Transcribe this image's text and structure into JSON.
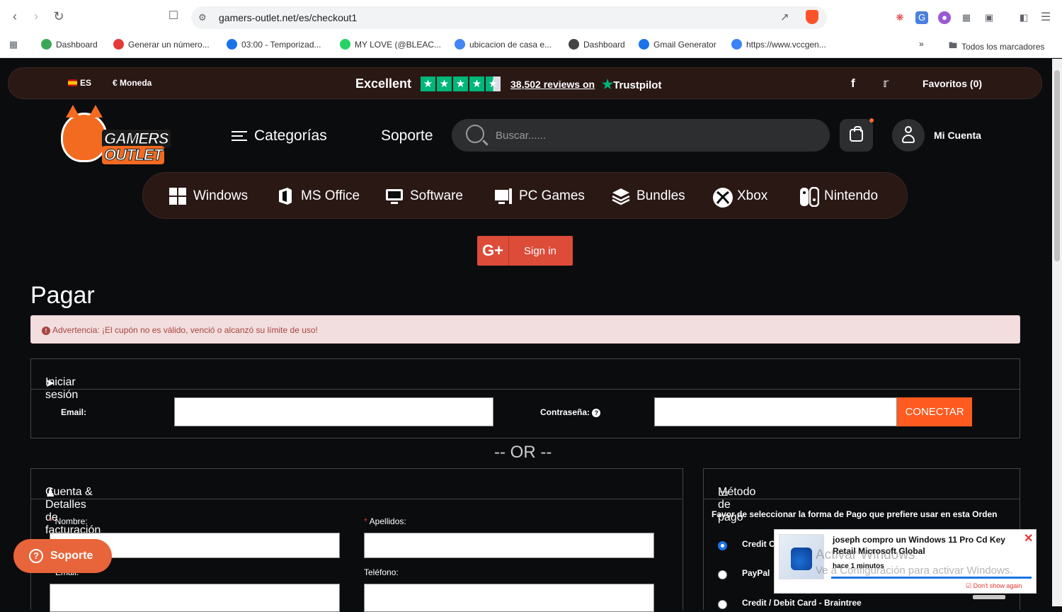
{
  "browser": {
    "url": "gamers-outlet.net/es/checkout1",
    "bookmarks": [
      {
        "label": "Dashboard",
        "color": "#3aa757",
        "icon": "dashboard-icon"
      },
      {
        "label": "Generar un número...",
        "color": "#e53935",
        "icon": "f-logo-icon"
      },
      {
        "label": "03:00 - Temporizad...",
        "color": "#1a73e8",
        "icon": "check-clock-icon"
      },
      {
        "label": "MY LOVE (@BLEAC...",
        "color": "#25d366",
        "icon": "whatsapp-icon"
      },
      {
        "label": "ubicacion de casa e...",
        "color": "#4285f4",
        "icon": "google-icon"
      },
      {
        "label": "Dashboard",
        "color": "#444444",
        "icon": "dashboard-dark-icon"
      },
      {
        "label": "Gmail Generator",
        "color": "#1a73e8",
        "icon": "gmail-generator-icon"
      },
      {
        "label": "https://www.vccgen...",
        "color": "#3b82f6",
        "icon": "v-logo-icon"
      }
    ],
    "all_bookmarks": "Todos los marcadores",
    "more": "»"
  },
  "topbar": {
    "lang": "ES",
    "currency": "€ Moneda",
    "rating_word": "Excellent",
    "reviews": "38,502 reviews on",
    "trustpilot": "Trustpilot",
    "favorites": "Favoritos (0)"
  },
  "header": {
    "logo_line1": "GAMERS",
    "logo_line2": "OUTLET",
    "categories": "Categorías",
    "support": "Soporte",
    "search_placeholder": "Buscar......",
    "account": "Mi Cuenta"
  },
  "platforms": [
    {
      "label": "Windows",
      "icon": "windows-icon"
    },
    {
      "label": "MS Office",
      "icon": "office-icon"
    },
    {
      "label": "Software",
      "icon": "software-icon"
    },
    {
      "label": "PC Games",
      "icon": "pc-games-icon"
    },
    {
      "label": "Bundles",
      "icon": "bundles-icon"
    },
    {
      "label": "Xbox",
      "icon": "xbox-icon"
    },
    {
      "label": "Nintendo",
      "icon": "nintendo-icon"
    }
  ],
  "google_signin": {
    "g": "G+",
    "label": "Sign in"
  },
  "page_title": "Pagar",
  "alert": "Advertencia: ¡El cupón no es válido, venció o alcanzó su límite de uso!",
  "login": {
    "title": "Iniciar sesión",
    "email_label": "Email:",
    "password_label": "Contraseña:",
    "connect": "CONECTAR"
  },
  "or_text": "-- OR --",
  "billing": {
    "title": "Cuenta & Detalles de facturación",
    "first_name": "Nombre:",
    "last_name": "Apellidos:",
    "email": "Email:",
    "phone": "Teléfono:"
  },
  "payment": {
    "title": "Método de pago",
    "note": "Favor de seleccionar la forma de Pago que prefiere usar en esta Orden",
    "options": [
      {
        "label": "Credit C",
        "selected": true
      },
      {
        "label": "PayPal",
        "selected": false
      },
      {
        "label": "Credit / Debit Card - Braintree",
        "selected": false
      }
    ]
  },
  "support_button": "Soporte",
  "toast": {
    "message": "joseph compro un Windows 11 Pro Cd Key Retail Microsoft Global",
    "ago": "hace 1 minutos",
    "dont_show": "Don't show again",
    "close": "✕"
  },
  "watermark": {
    "line1": "Activar Windows",
    "line2": "Ve a Configuración para activar Windows."
  }
}
